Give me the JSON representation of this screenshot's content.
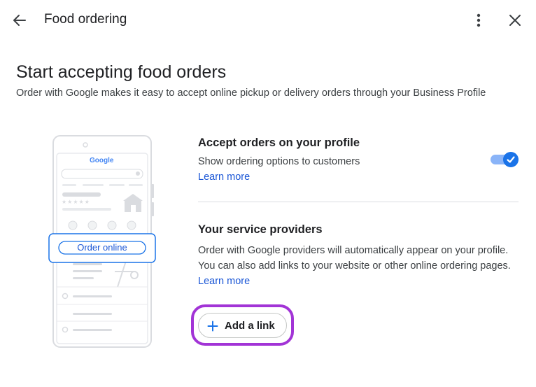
{
  "header": {
    "title": "Food ordering",
    "back_icon": "arrow-back-icon",
    "more_icon": "more-vert-icon",
    "close_icon": "close-icon"
  },
  "main": {
    "title": "Start accepting food orders",
    "subtitle": "Order with Google makes it easy to accept online pickup or delivery orders through your Business Profile"
  },
  "illustration": {
    "search_brand": "Google",
    "order_button_label": "Order online",
    "rating_stars": "★★★★★"
  },
  "accept_orders": {
    "title": "Accept orders on your profile",
    "description": "Show ordering options to customers",
    "learn_more": "Learn more",
    "toggle_on": true
  },
  "service_providers": {
    "title": "Your service providers",
    "description": "Order with Google providers will automatically appear on your profile. You can also add links to your website or other online ordering pages.",
    "learn_more": "Learn more",
    "add_link_label": "Add a link"
  },
  "colors": {
    "accent": "#1a73e8",
    "link": "#1a56d6",
    "highlight": "#a234d6"
  }
}
